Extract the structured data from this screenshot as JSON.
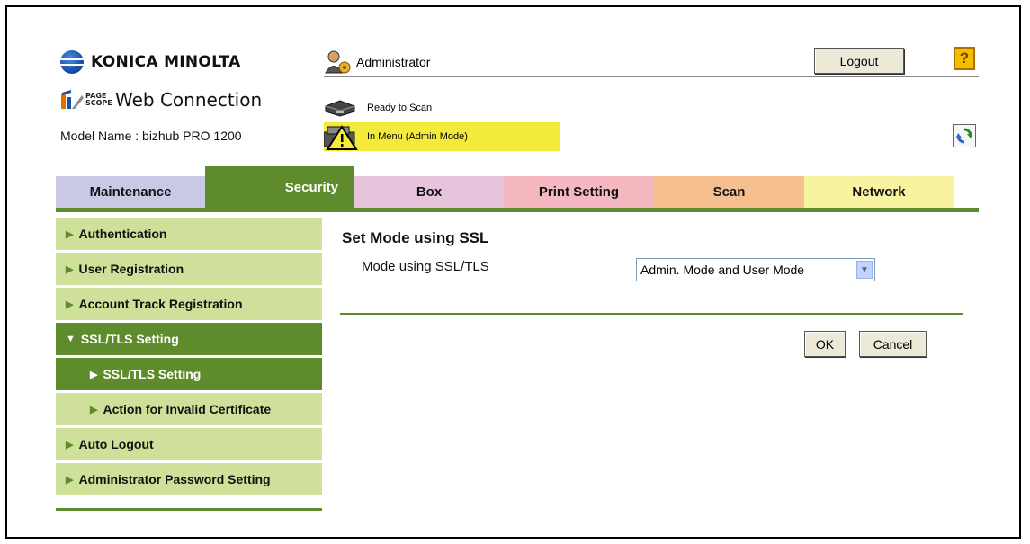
{
  "brand": {
    "name": "KONICA MINOLTA",
    "pagescope_small": "PAGE SCOPE",
    "product": "Web Connection",
    "model": "Model Name : bizhub PRO 1200"
  },
  "header": {
    "user": "Administrator",
    "logout_label": "Logout",
    "help_label": "?",
    "status_ready": "Ready to Scan",
    "status_menu": "In Menu (Admin Mode)"
  },
  "tabs": [
    {
      "label": "Maintenance",
      "color": "#c9c9e6"
    },
    {
      "label": "Security",
      "color": "#5e8c2c"
    },
    {
      "label": "Box",
      "color": "#e8c4dc"
    },
    {
      "label": "Print Setting",
      "color": "#f5b8c0"
    },
    {
      "label": "Scan",
      "color": "#f6bf8f"
    },
    {
      "label": "Network",
      "color": "#f7f3a0"
    }
  ],
  "sidebar": {
    "items": [
      {
        "label": "Authentication"
      },
      {
        "label": "User Registration"
      },
      {
        "label": "Account Track Registration"
      },
      {
        "label": "SSL/TLS Setting"
      },
      {
        "label": "SSL/TLS Setting"
      },
      {
        "label": "Action for Invalid Certificate"
      },
      {
        "label": "Auto Logout"
      },
      {
        "label": "Administrator Password Setting"
      }
    ]
  },
  "content": {
    "title": "Set Mode using SSL",
    "field_label": "Mode using SSL/TLS",
    "select_value": "Admin. Mode and User Mode",
    "ok_label": "OK",
    "cancel_label": "Cancel"
  },
  "colors": {
    "accent_green": "#5e8c2c",
    "sidebar_light": "#cfe09a",
    "status_yellow": "#f4ea3c"
  }
}
